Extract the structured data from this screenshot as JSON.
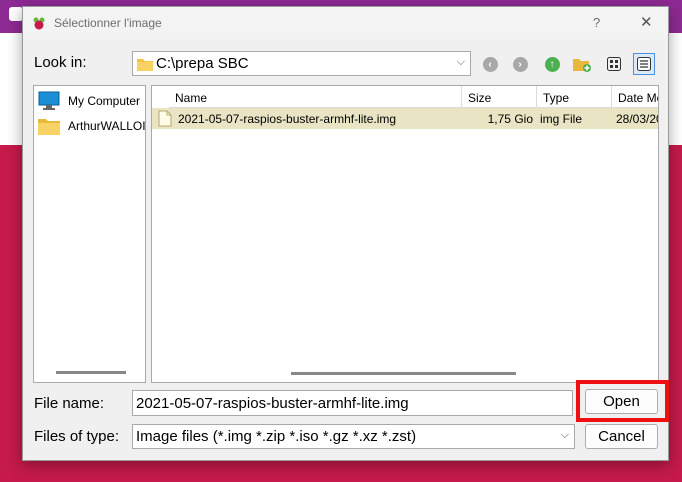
{
  "colors": {
    "background_top": "#8e2a93",
    "background_bottom": "#c51a4a",
    "highlight": "#ee1010",
    "selected_row": "#e8e4c4",
    "folder": "#f3c447"
  },
  "dialog": {
    "title": "Sélectionner l'image",
    "help": "?",
    "close": "✕"
  },
  "look_in": {
    "label": "Look in:",
    "value": "C:\\prepa SBC"
  },
  "toolbar": {
    "icons": [
      "back-icon",
      "forward-icon",
      "parent-folder-icon",
      "new-folder-icon",
      "list-view-icon",
      "detail-view-icon"
    ]
  },
  "sidebar": {
    "items": [
      {
        "label": "My Computer",
        "icon": "computer-icon"
      },
      {
        "label": "ArthurWALLOI",
        "icon": "folder-icon"
      }
    ]
  },
  "file_list": {
    "columns": [
      "Name",
      "Size",
      "Type",
      "Date Mo"
    ],
    "rows": [
      {
        "name": "2021-05-07-raspios-buster-armhf-lite.img",
        "size": "1,75 Gio",
        "type": "img File",
        "date": "28/03/20"
      }
    ]
  },
  "file_name": {
    "label": "File name:",
    "value": "2021-05-07-raspios-buster-armhf-lite.img"
  },
  "file_type": {
    "label": "Files of type:",
    "value": "Image files (*.img *.zip *.iso *.gz *.xz *.zst)"
  },
  "buttons": {
    "open": "Open",
    "cancel": "Cancel"
  }
}
